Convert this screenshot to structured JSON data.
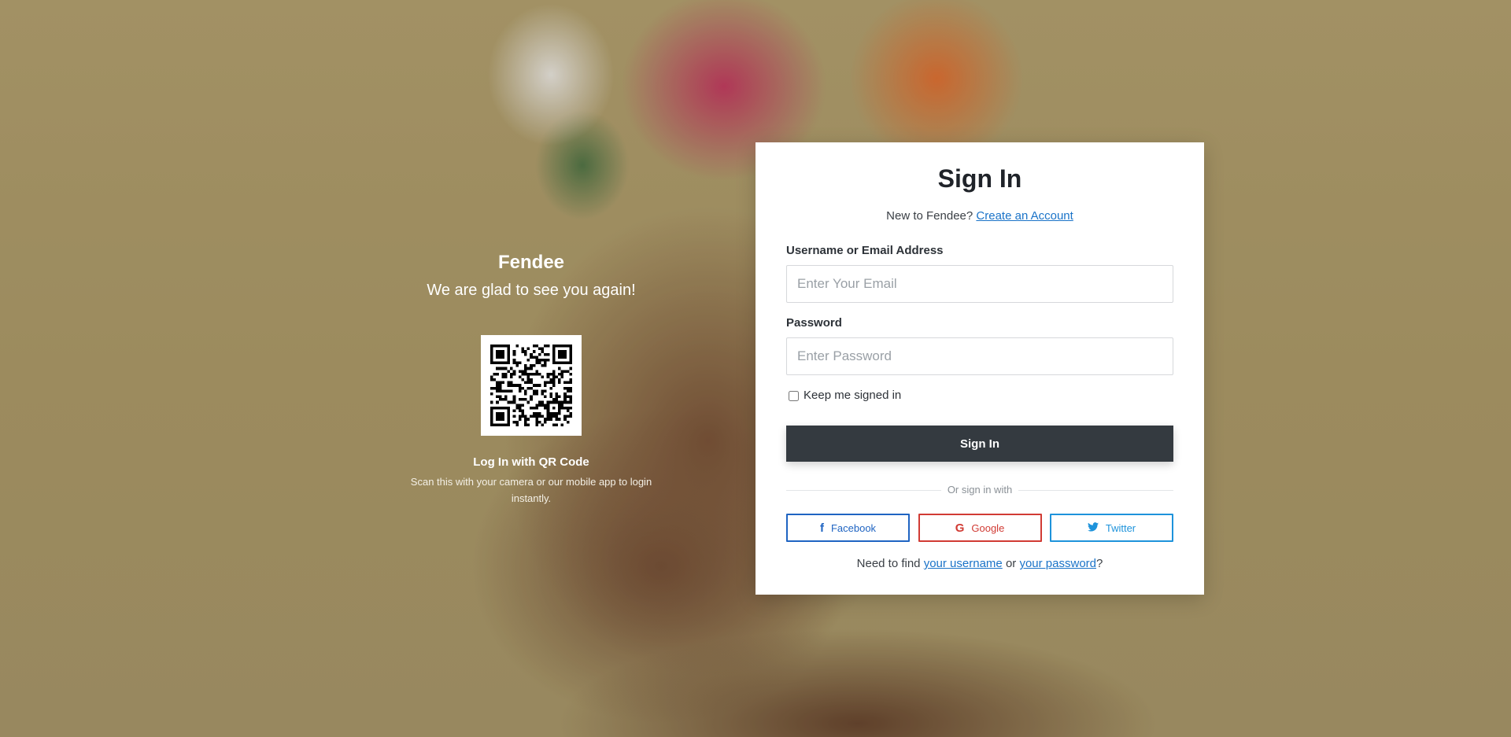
{
  "welcome": {
    "brand": "Fendee",
    "tagline": "We are glad to see you again!",
    "qr_title": "Log In with QR Code",
    "qr_desc": "Scan this with your camera or our mobile app to login instantly."
  },
  "signin": {
    "title": "Sign In",
    "new_prefix": "New to Fendee?",
    "create_account": "Create an Account",
    "username_label": "Username or Email Address",
    "username_placeholder": "Enter Your Email",
    "password_label": "Password",
    "password_placeholder": "Enter Password",
    "remember_label": "Keep me signed in",
    "remember_checked": false,
    "submit_label": "Sign In",
    "divider_text": "Or sign in with",
    "social": {
      "facebook": "Facebook",
      "google": "Google",
      "twitter": "Twitter"
    },
    "find_prefix": "Need to find",
    "find_username": "your username",
    "find_or": "or",
    "find_password": "your password",
    "find_suffix": "?"
  },
  "colors": {
    "background": "#ae9c6c",
    "card": "#ffffff",
    "primary_button": "#343a40",
    "link": "#1a73c8",
    "facebook": "#1f64c2",
    "google": "#d13b34",
    "twitter": "#1e93db"
  },
  "icons": {
    "facebook": "facebook-icon",
    "google": "google-icon",
    "twitter": "twitter-icon",
    "qr": "qr-code"
  }
}
